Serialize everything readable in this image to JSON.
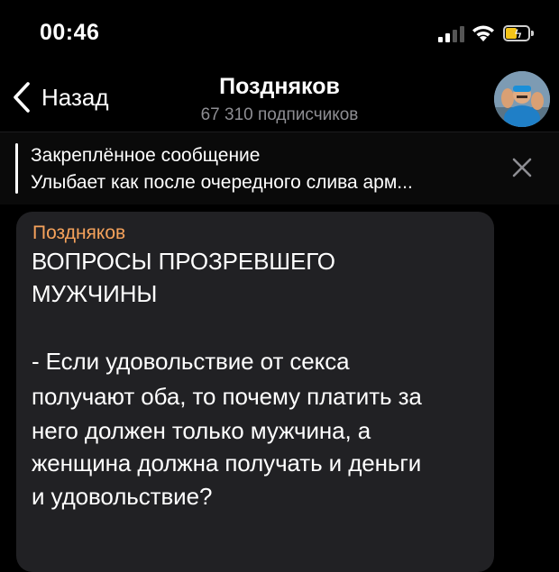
{
  "status_bar": {
    "time": "00:46",
    "battery_color": "#f5c518"
  },
  "nav": {
    "back_label": "Назад",
    "title": "Поздняков",
    "subscribers": "67 310 подписчиков",
    "icons": [
      "chevron-left-icon",
      "channel-avatar"
    ]
  },
  "pinned": {
    "title": "Закреплённое сообщение",
    "text": "Улыбает как после очередного слива арм...",
    "close_icon": "close-icon"
  },
  "message": {
    "sender": "Поздняков",
    "sender_color": "#f5a25b",
    "bubble_color": "#212124",
    "lines": [
      "ВОПРОСЫ ПРОЗРЕВШЕГО",
      "МУЖЧИНЫ",
      "",
      "- Если удовольствие от секса",
      "получают оба, то почему платить за",
      "него должен только мужчина, а",
      "женщина должна получать и деньги",
      "и удовольствие?"
    ]
  }
}
